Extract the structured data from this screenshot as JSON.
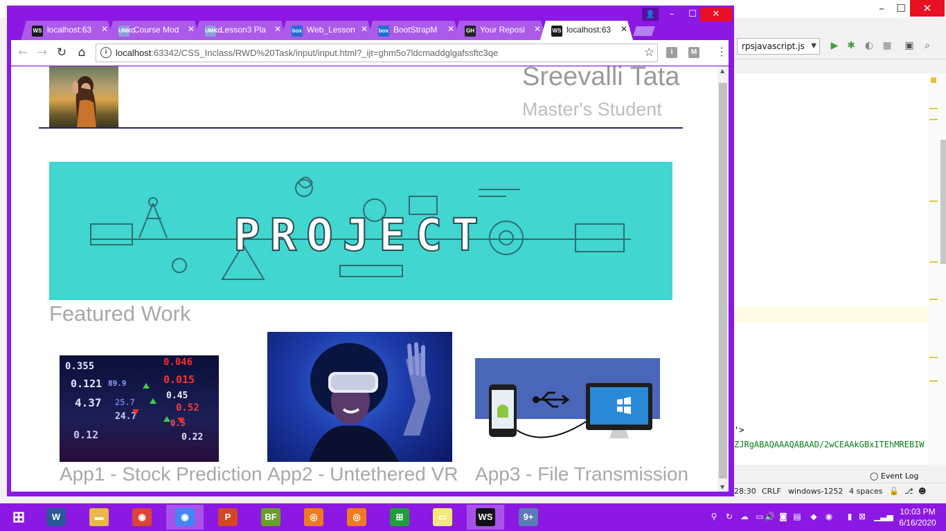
{
  "ide": {
    "run_config": "rpsjavascript.js",
    "code_line_1": "'>",
    "code_line_2": "ZJRgABAQAAAQABAAD/2wCEAAkGBxITEhMREBIW",
    "event_log": "Event Log",
    "status": {
      "position": "28:30",
      "line_sep": "CRLF",
      "encoding": "windows-1252",
      "indent": "4 spaces"
    },
    "colors": {
      "marker": "#e8c43a"
    }
  },
  "browser": {
    "frame_color": "#8c18e3",
    "tabs": [
      {
        "title": "localhost:63",
        "favicon": "WS",
        "favicon_color": "#1a1a1a",
        "active": false
      },
      {
        "title": "Course Mod",
        "favicon": "UMKC",
        "favicon_color": "#8a9fd8",
        "active": false
      },
      {
        "title": "Lesson3 Pla",
        "favicon": "UMKC",
        "favicon_color": "#8a9fd8",
        "active": false
      },
      {
        "title": "Web_Lesson",
        "favicon": "box",
        "favicon_color": "#1f6fd1",
        "active": false
      },
      {
        "title": "BootStrapM",
        "favicon": "box",
        "favicon_color": "#1f6fd1",
        "active": false
      },
      {
        "title": "Your Reposi",
        "favicon": "GH",
        "favicon_color": "#222222",
        "active": false
      },
      {
        "title": "localhost:63",
        "favicon": "WS",
        "favicon_color": "#1a1a1a",
        "active": true
      }
    ],
    "url_host": "localhost",
    "url_rest": ":63342/CSS_Inclass/RWD%20Task/input/input.html?_ijt=ghm5o7ldcmaddglgafssftc3qe",
    "extensions": [
      "I",
      "M"
    ]
  },
  "page": {
    "name": "Sreevalli Tata",
    "role": "Master's Student",
    "banner_word": "PROJECT",
    "featured_heading": "Featured Work",
    "apps": [
      {
        "caption": "App1 - Stock Prediction",
        "image": "stock-ticker-image"
      },
      {
        "caption": "App2 - Untethered VR",
        "image": "vr-headset-image"
      },
      {
        "caption": "App3 - File Transmission",
        "image": "phone-to-pc-usb-image"
      }
    ],
    "stock_numbers": [
      "0.355",
      "0.046",
      "0.121",
      "89.9",
      "0.015",
      "4.37",
      "25.7",
      "0.45",
      "24.7",
      "0.52",
      "0.5",
      "0.22",
      "0.12"
    ],
    "colors": {
      "banner_bg": "#41d6cf",
      "rule": "#2e1f6b",
      "text_gray": "#a8a8a8"
    }
  },
  "taskbar": {
    "apps": [
      {
        "name": "start-button",
        "glyph": "⊞",
        "color": "transparent"
      },
      {
        "name": "word",
        "glyph": "W",
        "color": "#2b579a"
      },
      {
        "name": "file-explorer",
        "glyph": "▬",
        "color": "#e8b84a"
      },
      {
        "name": "chrome",
        "glyph": "◉",
        "color": "#db4437"
      },
      {
        "name": "chrome-active",
        "glyph": "◉",
        "color": "#4285f4"
      },
      {
        "name": "powerpoint",
        "glyph": "P",
        "color": "#d24726"
      },
      {
        "name": "big-farm",
        "glyph": "BF",
        "color": "#6a9e2a"
      },
      {
        "name": "camera-app",
        "glyph": "◎",
        "color": "#f07a20"
      },
      {
        "name": "camera-app-2",
        "glyph": "◎",
        "color": "#f07a20"
      },
      {
        "name": "store",
        "glyph": "⊞",
        "color": "#1e9e3a"
      },
      {
        "name": "sticky-notes",
        "glyph": "▭",
        "color": "#f3e87a"
      },
      {
        "name": "webstorm",
        "glyph": "WS",
        "color": "#111111"
      },
      {
        "name": "notifications-app",
        "glyph": "9+",
        "color": "#5a7ab8"
      }
    ],
    "time": "10:03 PM",
    "date": "6/16/2020"
  }
}
